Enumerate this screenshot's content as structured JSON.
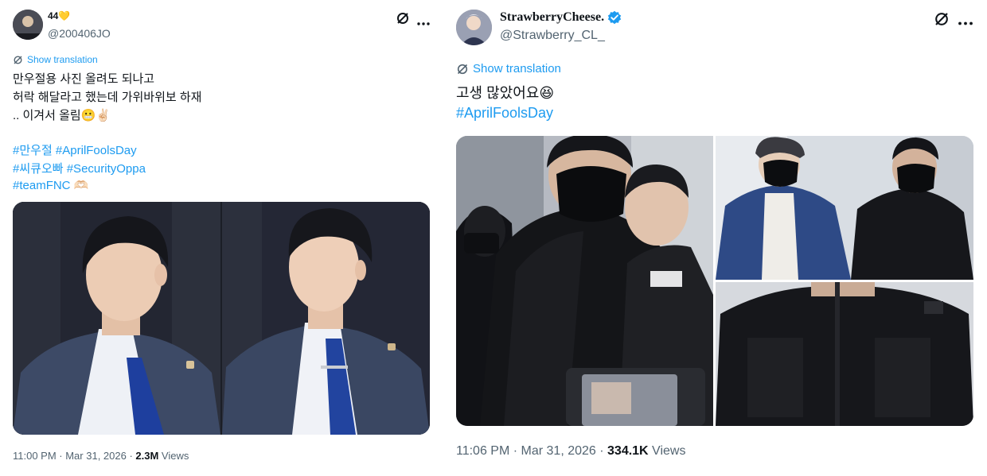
{
  "left": {
    "display_name": "44💛",
    "handle": "@200406JO",
    "translate_label": "Show translation",
    "lines": [
      "만우절용 사진 올려도 되나고",
      "허락 해달라고 했는데 가위바위보 하재",
      ".. 이겨서 올림😬✌🏻"
    ],
    "hashtag_lines": [
      [
        "#만우절",
        "#AprilFoolsDay"
      ],
      [
        "#씨큐오빠",
        "#SecurityOppa"
      ],
      [
        "#teamFNC 🫶🏻"
      ]
    ],
    "time": "11:00 PM · Mar 31, 2026 · ",
    "views_count": "2.3M",
    "views_label": " Views"
  },
  "right": {
    "display_name": "StrawberryCheese.",
    "handle": "@Strawberry_CL_",
    "translate_label": "Show translation",
    "text": "고생 많았어요😆",
    "hashtag": "#AprilFoolsDay",
    "time": "11:06 PM · Mar 31, 2026 · ",
    "views_count": "334.1K",
    "views_label": " Views"
  },
  "icons": {
    "grok": "grok-icon",
    "more": "more-icon",
    "translate": "translate-icon",
    "verified": "verified-badge-icon"
  },
  "colors": {
    "link": "#1d9bf0",
    "secondary_text": "#536471",
    "verified": "#1d9bf0"
  }
}
